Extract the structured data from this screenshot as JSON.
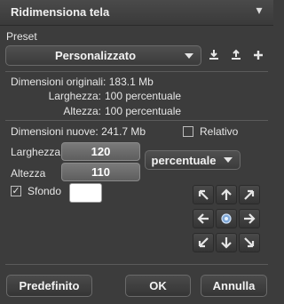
{
  "window": {
    "title": "Ridimensiona tela",
    "close_glyph": "▾"
  },
  "preset": {
    "label": "Preset",
    "selected": "Personalizzato"
  },
  "original": {
    "dimensions_label": "Dimensioni originali:",
    "dimensions_value": "183.1 Mb",
    "width_label": "Larghezza:",
    "width_value": "100 percentuale",
    "height_label": "Altezza:",
    "height_value": "100 percentuale"
  },
  "new": {
    "dimensions_label": "Dimensioni nuove:",
    "dimensions_value": "241.7 Mb",
    "relative_label": "Relativo",
    "relative_checked": false,
    "width_label": "Larghezza",
    "width_value": "120",
    "height_label": "Altezza",
    "height_value": "110",
    "unit": "percentuale",
    "background_label": "Sfondo",
    "background_checked": true,
    "background_color": "#ffffff",
    "checkmark": "✓"
  },
  "buttons": {
    "default": "Predefinito",
    "ok": "OK",
    "cancel": "Annulla"
  },
  "colors": {
    "panel": "#3c3c3c",
    "anchor_center": "#7fa8d8"
  }
}
